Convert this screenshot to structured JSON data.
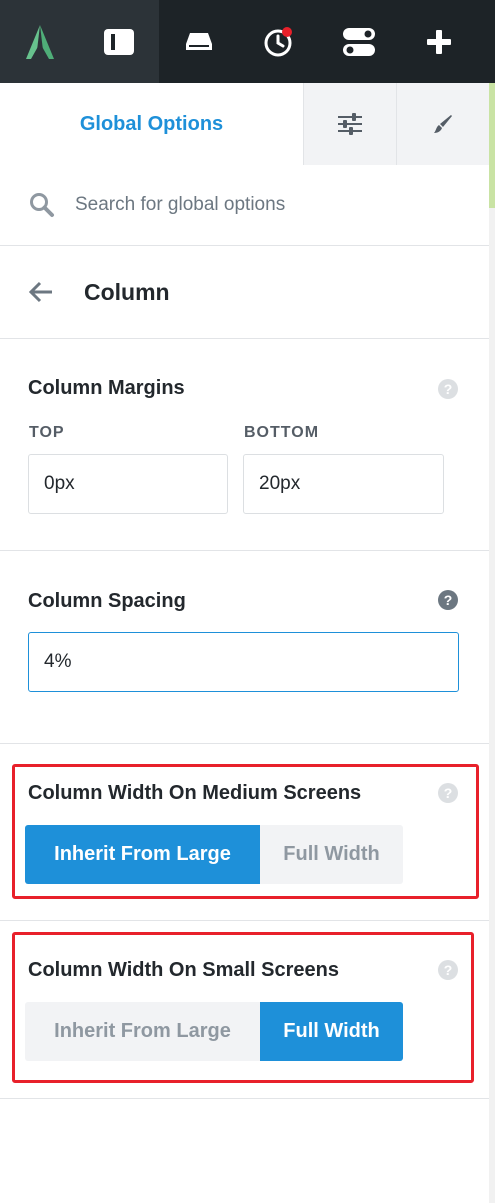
{
  "toolbar": {
    "logo_icon": "avada-logo-icon",
    "buttons": [
      {
        "icon": "sidebar-panel-icon",
        "active": true
      },
      {
        "icon": "drawer-icon",
        "active": false
      },
      {
        "icon": "history-icon",
        "active": false,
        "badge": true
      },
      {
        "icon": "toggles-icon",
        "active": false
      },
      {
        "icon": "plus-icon",
        "active": false
      }
    ]
  },
  "tabs": {
    "global_label": "Global Options",
    "settings_icon": "sliders-icon",
    "style_icon": "brush-icon"
  },
  "search": {
    "placeholder": "Search for global options",
    "value": ""
  },
  "breadcrumb": {
    "back_icon": "back-arrow-icon",
    "title": "Column"
  },
  "column_margins": {
    "label": "Column Margins",
    "top_label": "TOP",
    "bottom_label": "BOTTOM",
    "top_value": "0px",
    "bottom_value": "20px"
  },
  "column_spacing": {
    "label": "Column Spacing",
    "value": "4%"
  },
  "medium_screens": {
    "label": "Column Width On Medium Screens",
    "options": [
      "Inherit From Large",
      "Full Width"
    ],
    "selected": "Inherit From Large"
  },
  "small_screens": {
    "label": "Column Width On Small Screens",
    "options": [
      "Inherit From Large",
      "Full Width"
    ],
    "selected": "Full Width"
  },
  "colors": {
    "accent": "#1e90d9",
    "topbar": "#1d2327",
    "highlight": "#e8202a",
    "logo": "#67c28d"
  }
}
